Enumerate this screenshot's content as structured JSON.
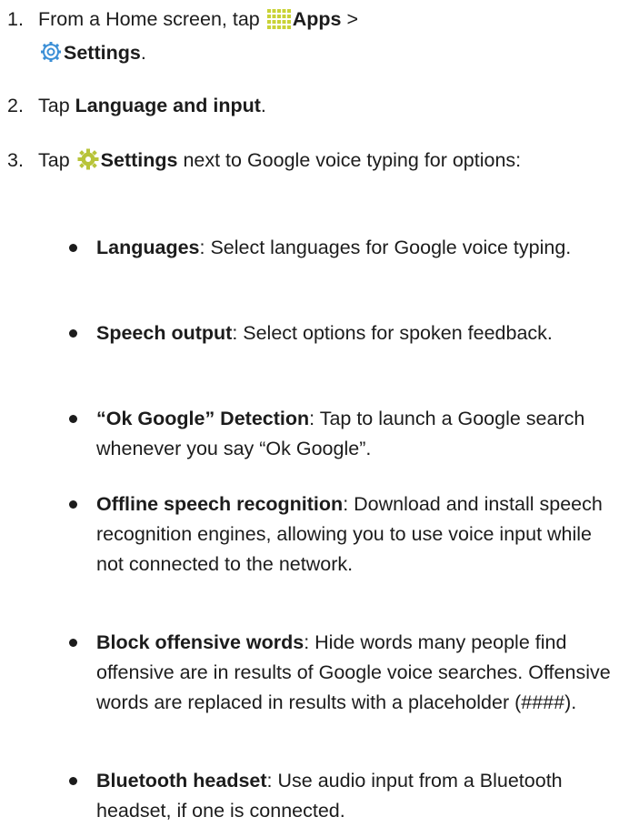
{
  "steps": [
    {
      "number": "1.",
      "prefix": "From a Home screen, tap ",
      "apps_icon": "apps-grid-icon",
      "apps_label": "Apps",
      "separator": " >",
      "settings_icon": "settings-gear-icon",
      "settings_label": "Settings",
      "suffix": "."
    },
    {
      "number": "2.",
      "prefix": "Tap ",
      "bold": "Language and input",
      "suffix": "."
    },
    {
      "number": "3.",
      "prefix": "Tap ",
      "icon": "settings-cog-icon",
      "bold": "Settings",
      "suffix": " next to Google voice typing for options:"
    }
  ],
  "options": [
    {
      "term": "Languages",
      "description": ": Select languages for Google voice typing."
    },
    {
      "term": "Speech output",
      "description": ": Select options for spoken feedback."
    },
    {
      "term": "“Ok Google” Detection",
      "description": ": Tap to launch a Google search whenever you say “Ok Google”."
    },
    {
      "term": "Offline speech recognition",
      "description": ": Download and install speech recognition engines, allowing you to use voice input while not connected to the network."
    },
    {
      "term": "Block offensive words",
      "description": ": Hide words many people find offensive are in results of Google voice searches. Offensive words are replaced in results with a placeholder (####)."
    },
    {
      "term": "Bluetooth headset",
      "description": ": Use audio input from a Bluetooth headset, if one is connected."
    }
  ],
  "colors": {
    "text": "#1c1c1c",
    "apps_icon": "#c9d236",
    "settings_icon_ring": "#3b8fd6",
    "cog_icon": "#b8c43a"
  }
}
